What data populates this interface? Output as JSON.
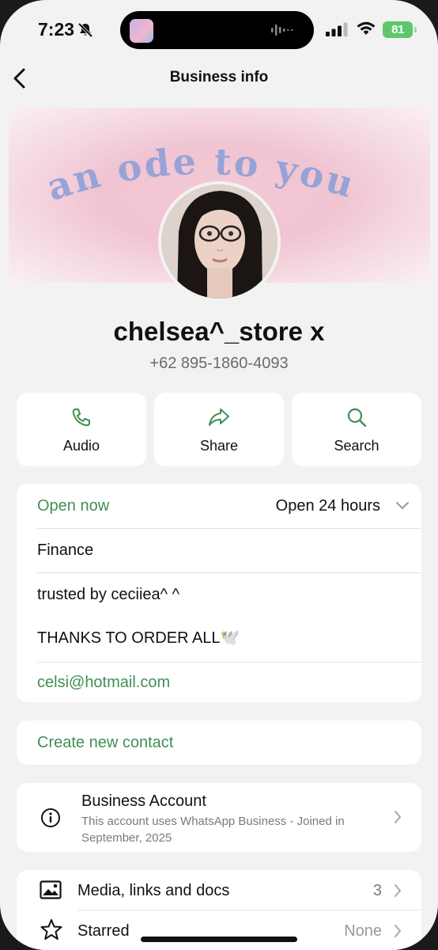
{
  "status_bar": {
    "time": "7:23",
    "battery": "81",
    "icons": [
      "bell-slash-icon",
      "audio-wave-icon",
      "signal-icon",
      "wifi-icon",
      "battery-icon"
    ]
  },
  "nav": {
    "title": "Business info",
    "back_icon": "chevron-left-icon"
  },
  "banner": {
    "text": "an ode to you"
  },
  "profile": {
    "name": "chelsea^_store x",
    "phone": "+62 895-1860-4093"
  },
  "actions": [
    {
      "label": "Audio",
      "icon": "phone-icon"
    },
    {
      "label": "Share",
      "icon": "share-icon"
    },
    {
      "label": "Search",
      "icon": "search-icon"
    }
  ],
  "business_details": {
    "status": "Open now",
    "hours": "Open 24 hours",
    "category": "Finance",
    "description_line1": "trusted by ceciiea^ ^",
    "description_line2": "THANKS TO ORDER ALL🕊️",
    "email": "celsi@hotmail.com"
  },
  "create_contact": {
    "label": "Create new contact"
  },
  "business_account": {
    "title": "Business Account",
    "description": "This account uses WhatsApp Business - Joined in September, 2025"
  },
  "media": {
    "label": "Media, links and docs",
    "count": "3"
  },
  "starred": {
    "label": "Starred",
    "value": "None"
  },
  "colors": {
    "accent_green": "#3f8f55",
    "background": "#f2f2f2",
    "battery_green": "#5fc76b"
  }
}
